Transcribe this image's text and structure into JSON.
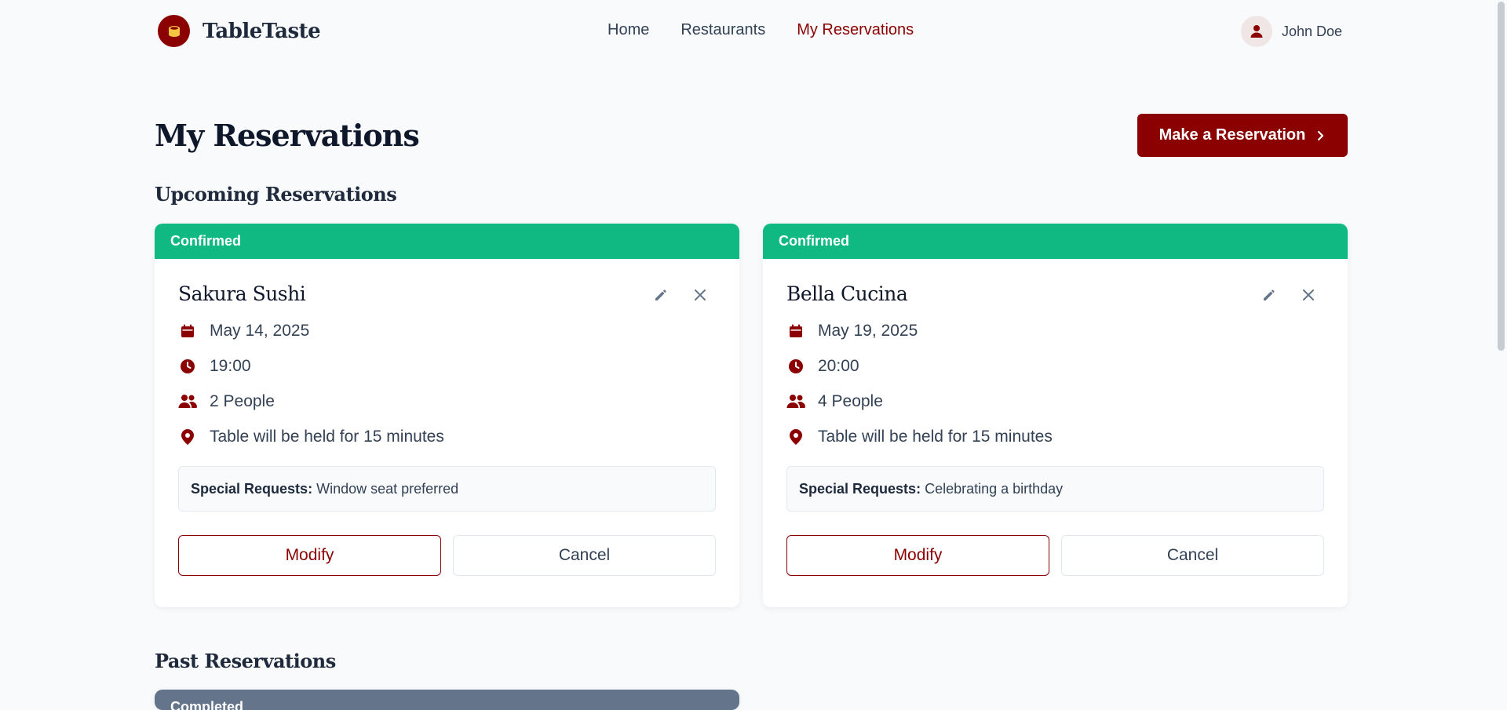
{
  "brand": {
    "name": "TableTaste",
    "accent": "#8b0000",
    "success": "#10b981",
    "muted": "#64748b"
  },
  "nav": {
    "items": [
      {
        "label": "Home"
      },
      {
        "label": "Restaurants"
      },
      {
        "label": "My Reservations"
      }
    ],
    "active": "My Reservations"
  },
  "user": {
    "name": "John Doe"
  },
  "page": {
    "title": "My Reservations",
    "make_reservation_label": "Make a Reservation"
  },
  "upcoming": {
    "title": "Upcoming Reservations",
    "reservations": [
      {
        "status": "Confirmed",
        "restaurant": "Sakura Sushi",
        "date": "May 14, 2025",
        "time": "19:00",
        "party": "2 People",
        "hold_note": "Table will be held for 15 minutes",
        "requests_label": "Special Requests:",
        "requests": "Window seat preferred",
        "modify_label": "Modify",
        "cancel_label": "Cancel"
      },
      {
        "status": "Confirmed",
        "restaurant": "Bella Cucina",
        "date": "May 19, 2025",
        "time": "20:00",
        "party": "4 People",
        "hold_note": "Table will be held for 15 minutes",
        "requests_label": "Special Requests:",
        "requests": "Celebrating a birthday",
        "modify_label": "Modify",
        "cancel_label": "Cancel"
      }
    ]
  },
  "past": {
    "title": "Past Reservations",
    "reservations": [
      {
        "status": "Completed"
      }
    ]
  }
}
